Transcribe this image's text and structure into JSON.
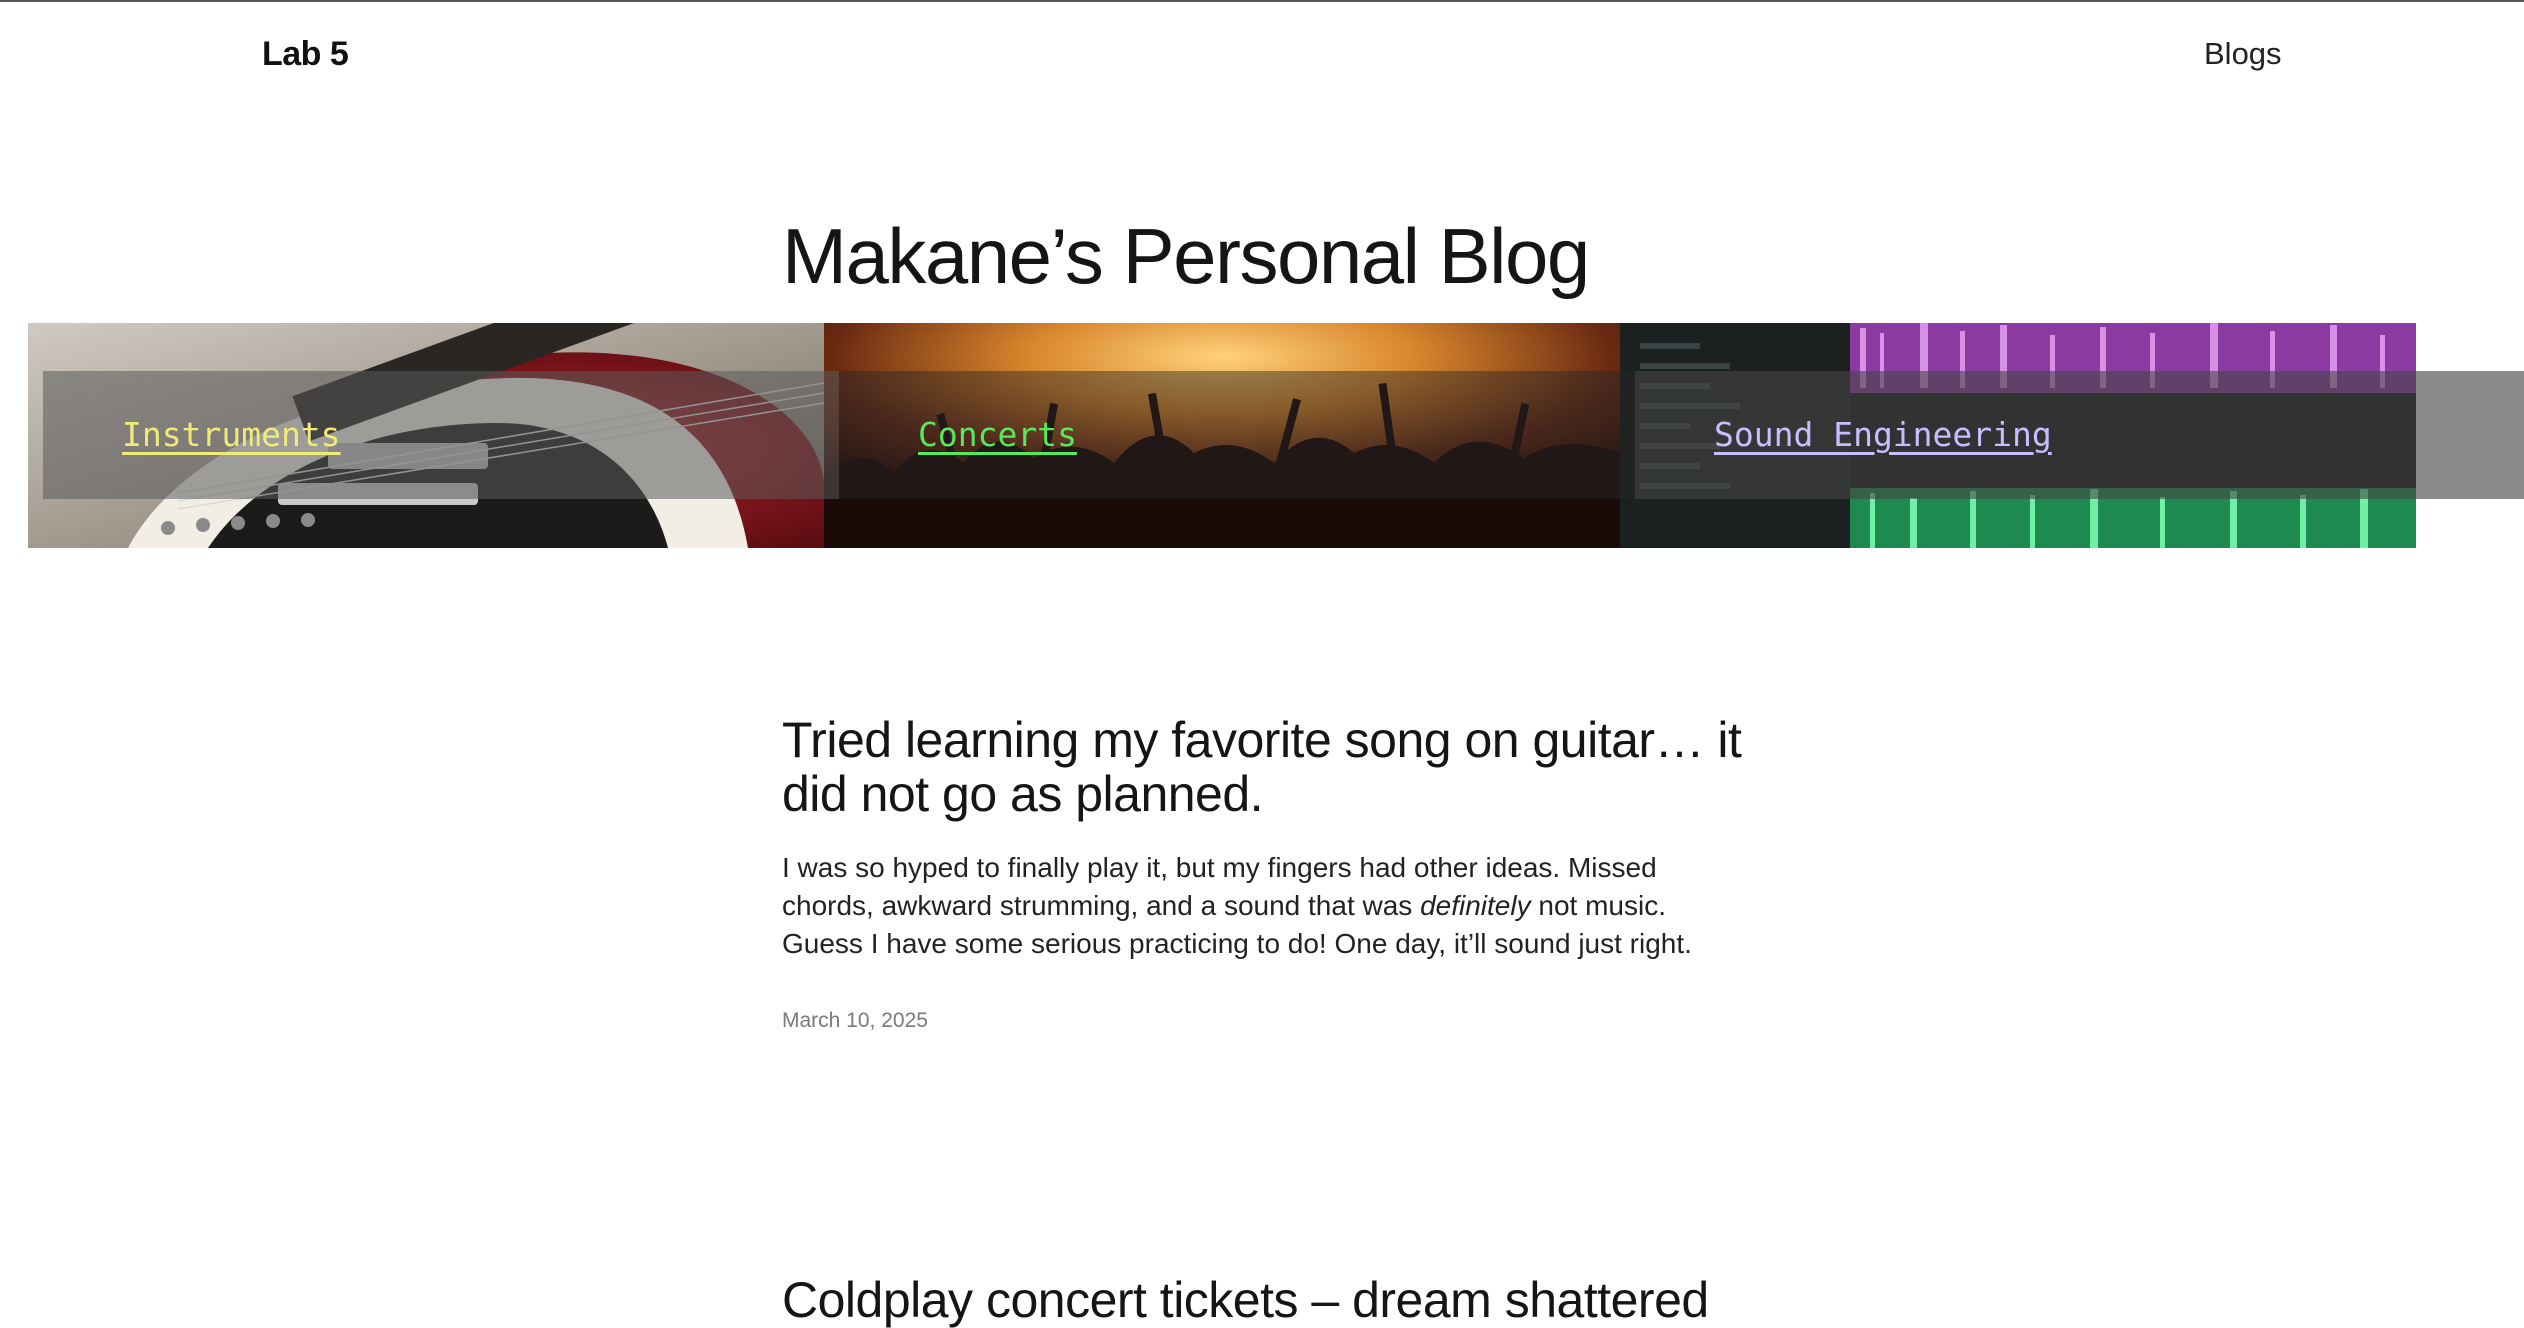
{
  "header": {
    "brand": "Lab 5",
    "nav": [
      {
        "label": "Blogs"
      }
    ]
  },
  "hero": {
    "title": "Makane’s Personal Blog"
  },
  "categories": [
    {
      "label": "Instruments",
      "color": "#f0ea78",
      "image": "electric-guitar-photo"
    },
    {
      "label": "Concerts",
      "color": "#58e85c",
      "image": "concert-crowd-photo"
    },
    {
      "label": "Sound Engineering",
      "color": "#c9bcff",
      "image": "daw-timeline-photo"
    }
  ],
  "posts": [
    {
      "title": "Tried learning my favorite song on guitar… it did not go as planned.",
      "body_before": "I was so hyped to finally play it, but my fingers had other ideas. Missed chords, awkward strumming, and a sound that was ",
      "body_emphasis": "definitely",
      "body_after": " not music. Guess I have some serious practicing to do! One day, it’ll sound just right.",
      "date": "March 10, 2025"
    },
    {
      "title": "Coldplay concert tickets – dream shattered"
    }
  ]
}
